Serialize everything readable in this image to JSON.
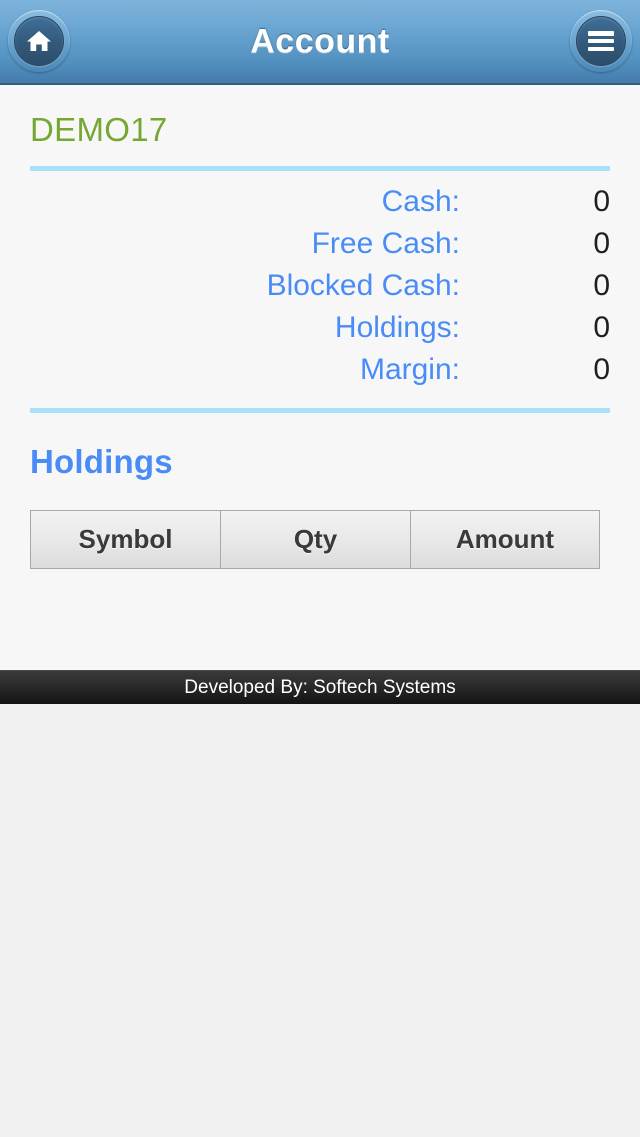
{
  "header": {
    "title": "Account",
    "home_icon": "home-icon",
    "menu_icon": "hamburger-menu-icon"
  },
  "account": {
    "name": "DEMO17",
    "stats": [
      {
        "label": "Cash:",
        "value": "0"
      },
      {
        "label": "Free Cash:",
        "value": "0"
      },
      {
        "label": "Blocked Cash:",
        "value": "0"
      },
      {
        "label": "Holdings:",
        "value": "0"
      },
      {
        "label": "Margin:",
        "value": "0"
      }
    ]
  },
  "holdings": {
    "title": "Holdings",
    "columns": [
      "Symbol",
      "Qty",
      "Amount"
    ],
    "rows": []
  },
  "footer": {
    "text": "Developed By: Softech Systems"
  },
  "colors": {
    "header_blue_top": "#7eb4db",
    "header_blue_bottom": "#447cac",
    "account_name_green": "#76a733",
    "label_blue": "#4a8cf7",
    "divider_blue": "#aadff8",
    "footer_black": "#131313"
  }
}
